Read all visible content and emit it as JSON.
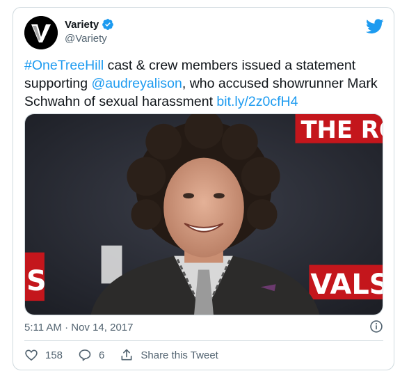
{
  "tweet": {
    "author_name": "Variety",
    "author_handle": "@Variety",
    "verified": true,
    "text_parts": {
      "hashtag": "#OneTreeHill",
      "part1": " cast & crew members issued a statement supporting ",
      "mention": "@audreyalison",
      "part2": ", who accused showrunner Mark Schwahn of sexual harassment ",
      "url": "bit.ly/2z0cfH4"
    },
    "photo_sign_text_top": "THE RO",
    "photo_sign_text_bottom": "VALS",
    "photo_sign_text_left": "S",
    "timestamp": "5:11 AM · Nov 14, 2017",
    "likes": "158",
    "replies": "6",
    "share_label": "Share this Tweet"
  },
  "colors": {
    "link": "#1d9bf0",
    "secondary_text": "#536471",
    "border": "#cfd9de",
    "twitter_blue": "#1d9bf0"
  },
  "icons": {
    "logo": "variety-logo-icon",
    "verified": "verified-badge-icon",
    "bird": "twitter-bird-icon",
    "info": "info-icon",
    "like": "heart-icon",
    "reply": "reply-bubble-icon",
    "share": "share-icon"
  }
}
